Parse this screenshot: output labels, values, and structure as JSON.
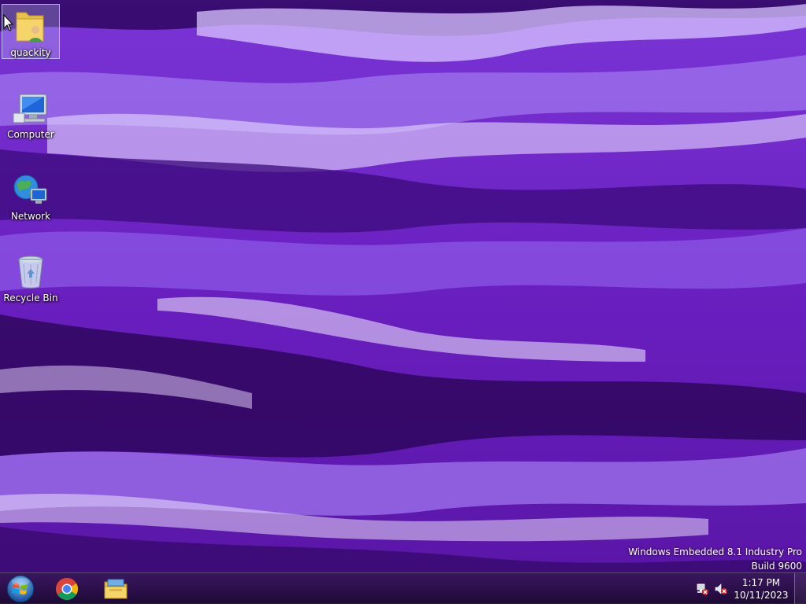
{
  "desktop": {
    "icons": [
      {
        "label": "quackity",
        "icon": "user-folder-icon",
        "selected": true
      },
      {
        "label": "Computer",
        "icon": "computer-icon"
      },
      {
        "label": "Network",
        "icon": "network-globe-icon"
      },
      {
        "label": "Recycle Bin",
        "icon": "recycle-bin-icon"
      }
    ],
    "watermark": {
      "edition": "Windows Embedded 8.1 Industry Pro",
      "build": "Build 9600"
    }
  },
  "taskbar": {
    "start": {
      "icon": "windows-start-orb-icon"
    },
    "pinned": [
      {
        "name": "Google Chrome",
        "icon": "chrome-icon"
      },
      {
        "name": "File Explorer",
        "icon": "file-explorer-icon"
      }
    ],
    "tray": {
      "icons": [
        "network-disconnected-icon",
        "speaker-muted-icon"
      ],
      "time": "1:17 PM",
      "date": "10/11/2023"
    }
  },
  "colors": {
    "wallpaper_base": "#6a1fc0",
    "wallpaper_dark": "#3a0a70",
    "wallpaper_light": "#b48cf5",
    "taskbar": "#2a0f4a"
  }
}
